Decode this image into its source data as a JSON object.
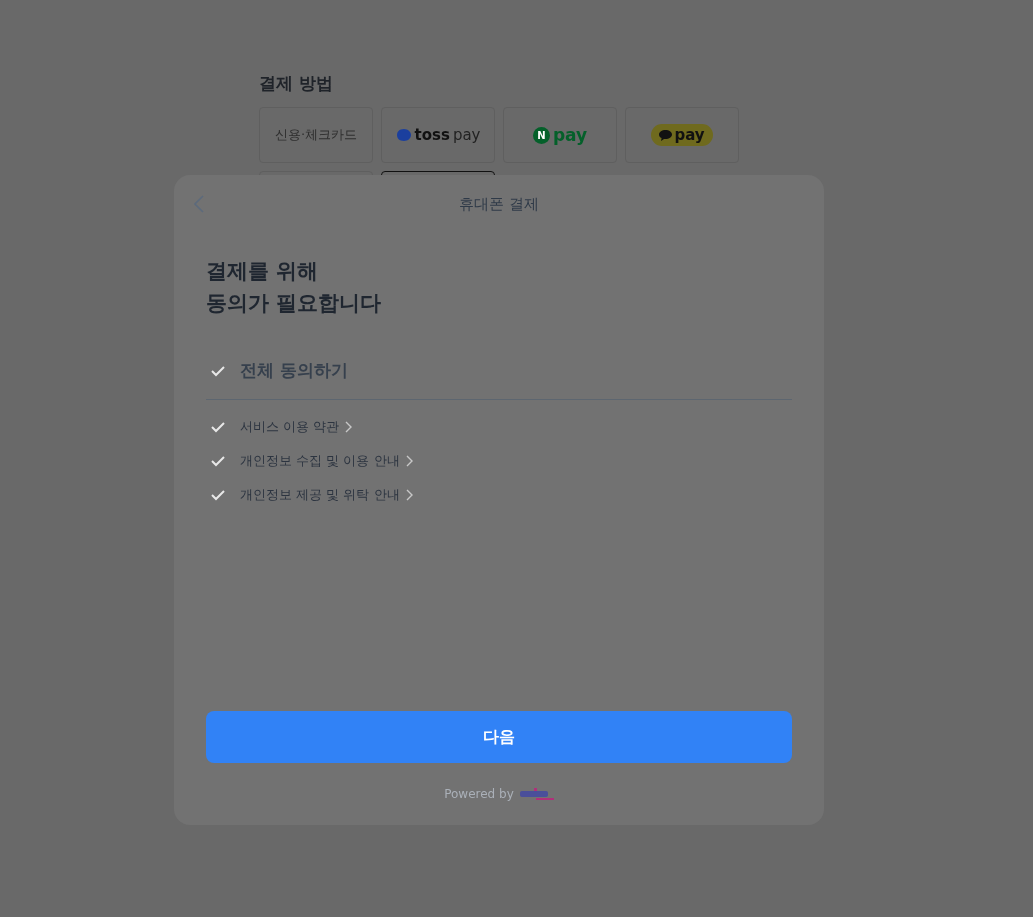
{
  "payment_section": {
    "title": "결제 방법",
    "methods": [
      {
        "kind": "text",
        "label": "신용·체크카드",
        "selected": false
      },
      {
        "kind": "toss",
        "logo_word": "toss",
        "label": "pay",
        "selected": false
      },
      {
        "kind": "naver",
        "logo_word": "N",
        "label": "pay",
        "selected": false
      },
      {
        "kind": "kakao",
        "label": "pay",
        "selected": false
      },
      {
        "kind": "blank",
        "selected": false
      },
      {
        "kind": "blank",
        "selected": true
      }
    ]
  },
  "modal": {
    "title": "휴대폰 결제",
    "heading": [
      "결제를 위해",
      "동의가 필요합니다"
    ],
    "agree_all": {
      "label": "전체 동의하기",
      "checked": true
    },
    "terms": [
      {
        "label": "서비스 이용 약관",
        "checked": true
      },
      {
        "label": "개인정보 수집 및 이용 안내",
        "checked": true
      },
      {
        "label": "개인정보 제공 및 위탁 안내",
        "checked": true
      }
    ],
    "next_button": "다음",
    "powered_by": "Powered by"
  }
}
